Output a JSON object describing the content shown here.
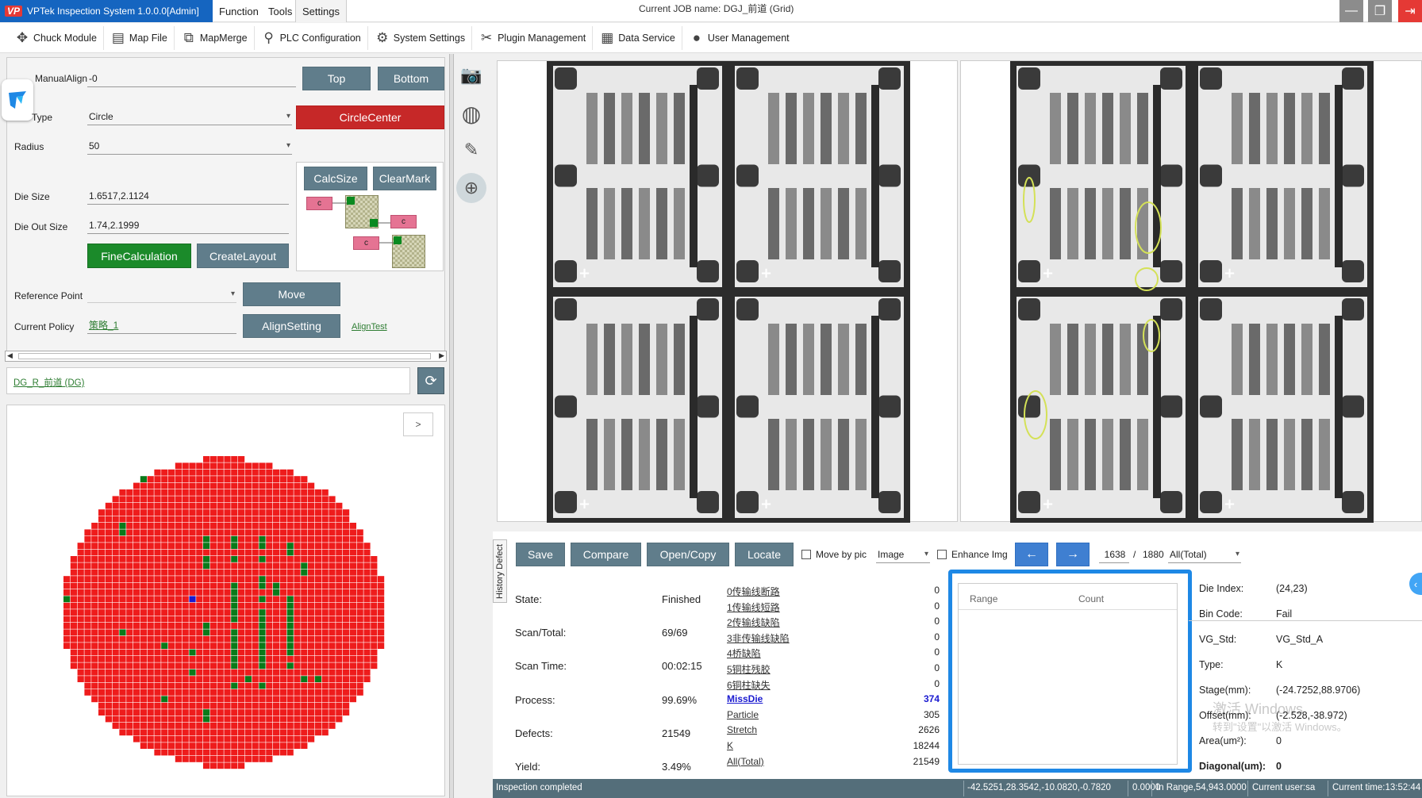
{
  "titlebar": {
    "app_title": "VPTek Inspection System 1.0.0.0[Admin]",
    "logo": "VP",
    "menus": [
      "Function",
      "Tools",
      "Settings"
    ],
    "job_name": "Current JOB name:  DGJ_前道 (Grid)"
  },
  "toolbar": {
    "items": [
      {
        "label": "Chuck Module",
        "icon": "chuck-icon"
      },
      {
        "label": "Map File",
        "icon": "map-file-icon"
      },
      {
        "label": "MapMerge",
        "icon": "map-merge-icon"
      },
      {
        "label": "PLC Configuration",
        "icon": "plc-icon"
      },
      {
        "label": "System Settings",
        "icon": "gear-icon"
      },
      {
        "label": "Plugin Management",
        "icon": "tools-icon"
      },
      {
        "label": "Data Service",
        "icon": "data-service-icon"
      },
      {
        "label": "User Management",
        "icon": "user-icon"
      }
    ]
  },
  "left": {
    "manual_align_label": "ManualAlign",
    "manual_align_value": "-0",
    "type_label": "Type",
    "type_value": "Circle",
    "radius_label": "Radius",
    "radius_value": "50",
    "die_size_label": "Die Size",
    "die_size_value": "1.6517,2.1124",
    "die_out_size_label": "Die Out Size",
    "die_out_size_value": "1.74,2.1999",
    "top_btn": "Top",
    "bottom_btn": "Bottom",
    "circle_center_btn": "CircleCenter",
    "calc_size_btn": "CalcSize",
    "clear_mark_btn": "ClearMark",
    "fine_calc_btn": "FineCalculation",
    "create_layout_btn": "CreateLayout",
    "c_label": "c",
    "reference_point_label": "Reference Point",
    "reference_point_value": "",
    "move_btn": "Move",
    "current_policy_label": "Current Policy",
    "current_policy_value": "策略_1",
    "align_setting_btn": "AlignSetting",
    "align_test_link": "AlignTest",
    "job_link": "DG_R_前道 (DG)",
    "map_expand": ">"
  },
  "wafer_map": {
    "colors": {
      "fail": "#ee1c1c",
      "pass": "#0a7a1a",
      "current": "#1a1ad0"
    },
    "current_die": [
      24,
      23
    ]
  },
  "bottom": {
    "history_tab": "History Defect",
    "save_btn": "Save",
    "compare_btn": "Compare",
    "open_copy_btn": "Open/Copy",
    "locate_btn": "Locate",
    "move_by_pic_label": "Move by pic",
    "image_select": "Image",
    "enhance_label": "Enhance Img",
    "prev_icon": "←",
    "next_icon": "→",
    "page_current": "1638",
    "page_sep": "/",
    "page_total": "1880",
    "filter": "All(Total)",
    "stats": [
      {
        "label": "State:",
        "value": "Finished"
      },
      {
        "label": "Scan/Total:",
        "value": "69/69"
      },
      {
        "label": "Scan Time:",
        "value": "00:02:15"
      },
      {
        "label": "Process:",
        "value": "99.69%"
      },
      {
        "label": "Defects:",
        "value": "21549"
      },
      {
        "label": "Yield:",
        "value": "3.49%"
      }
    ],
    "defects": [
      {
        "label": "0传输线断路",
        "count": "0"
      },
      {
        "label": "1传输线短路",
        "count": "0"
      },
      {
        "label": "2传输线缺陷",
        "count": "0"
      },
      {
        "label": "3非传输线缺陷",
        "count": "0"
      },
      {
        "label": "4桥缺陷",
        "count": "0"
      },
      {
        "label": "5铜柱残胶",
        "count": "0"
      },
      {
        "label": "6铜柱缺失",
        "count": "0"
      },
      {
        "label": "MissDie",
        "count": "374"
      },
      {
        "label": "Particle",
        "count": "305"
      },
      {
        "label": "Stretch",
        "count": "2626"
      },
      {
        "label": "K",
        "count": "18244"
      },
      {
        "label": "All(Total)",
        "count": "21549"
      }
    ],
    "range_header": "Range",
    "count_header": "Count"
  },
  "info": {
    "die_index_label": "Die Index:",
    "die_index_value": "(24,23)",
    "bin_code_label": "Bin Code:",
    "bin_code_value": "Fail",
    "vg_std_label": "VG_Std:",
    "vg_std_value": "VG_Std_A",
    "type_label": "Type:",
    "type_value": "K",
    "stage_label": "Stage(mm):",
    "stage_value": "(-24.7252,88.9706)",
    "offset_label": "Offset(mm):",
    "offset_value": "(-2.528,-38.972)",
    "area_label": "Area(um²):",
    "area_value": "0",
    "diagonal_label": "Diagonal(um):",
    "diagonal_value": "0",
    "watermark1": "激活 Windows",
    "watermark2": "转到\"设置\"以激活 Windows。"
  },
  "status": {
    "message": "Inspection completed",
    "coords": "-42.5251,28.3542,-10.0820,-0.7820",
    "zero": "0.0000",
    "range": "In Range,54,943.0000",
    "user": "Current user:sa",
    "time": "Current time:13:52:44"
  }
}
